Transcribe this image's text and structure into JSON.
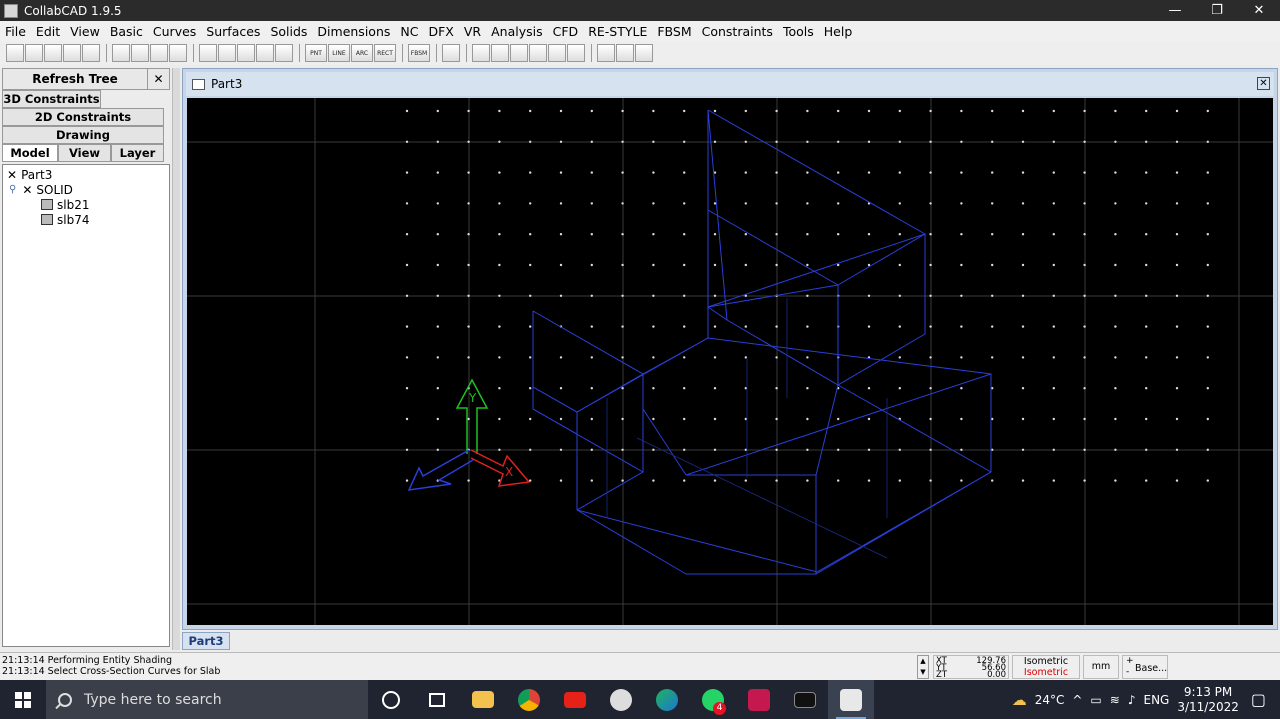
{
  "window": {
    "title": "CollabCAD 1.9.5",
    "minimize": "—",
    "restore": "❐",
    "close": "✕"
  },
  "menu": [
    "File",
    "Edit",
    "View",
    "Basic",
    "Curves",
    "Surfaces",
    "Solids",
    "Dimensions",
    "NC",
    "DFX",
    "VR",
    "Analysis",
    "CFD",
    "RE-STYLE",
    "FBSM",
    "Constraints",
    "Tools",
    "Help"
  ],
  "toolbar": {
    "buttons": [
      "new",
      "open",
      "save",
      "print",
      "undo",
      "redo",
      "copy",
      "fit",
      "delete",
      "select",
      "trim",
      "xform",
      "shape",
      "zoom",
      "PNT",
      "LINE",
      "ARC",
      "RECT",
      "FBSM",
      "move",
      "grid",
      "rotate",
      "text",
      "shade",
      "axis",
      "pointer",
      "tree",
      "palette",
      "capture"
    ]
  },
  "left_panel": {
    "refresh_label": "Refresh Tree",
    "close_label": "✕",
    "tabs_row1": "3D Constraints",
    "tabs_row2": "2D Constraints",
    "tabs_row3": "Drawing",
    "tabs_bottom": [
      "Model",
      "View",
      "Layer"
    ],
    "tree": [
      {
        "level": 0,
        "label": "Part3",
        "marker": "✕"
      },
      {
        "level": 1,
        "label": "SOLID",
        "marker": "✕"
      },
      {
        "level": 2,
        "label": "slb21"
      },
      {
        "level": 2,
        "label": "slb74"
      }
    ]
  },
  "document": {
    "title": "Part3",
    "close": "✕",
    "bottom_tab": "Part3"
  },
  "axes": {
    "x": "X",
    "y": "Y"
  },
  "status": {
    "log": [
      "21:13:14 Performing Entity Shading",
      "21:13:14 Select Cross-Section Curves for Slab"
    ],
    "coords": [
      {
        "label": "XT",
        "value": "129.76"
      },
      {
        "label": "YT",
        "value": "56.60"
      },
      {
        "label": "ZT",
        "value": "0.00"
      }
    ],
    "view_top": "Isometric",
    "view_bottom": "Isometric",
    "unit": "mm",
    "base": "Base..."
  },
  "taskbar": {
    "search_placeholder": "Type here to search",
    "weather": "24°C",
    "lang": "ENG",
    "time": "9:13 PM",
    "date": "3/11/2022",
    "whatsapp_badge": "4"
  },
  "colors": {
    "wire": "#2a3fd8",
    "axis_x": "#e02020",
    "axis_y": "#20c020",
    "axis_z": "#2a3fd8"
  }
}
